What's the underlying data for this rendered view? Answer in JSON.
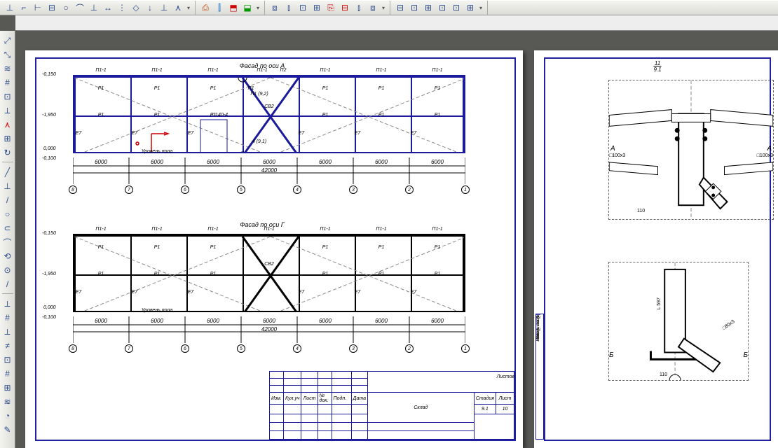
{
  "toolbars": {
    "top_groups": [
      [
        "⊥",
        "⌐",
        "⊢",
        "⊟",
        "○",
        "⌒",
        "⊥",
        "↔",
        "⋮",
        "◇",
        "↓",
        "⊥",
        "⋏"
      ],
      [
        "▸"
      ],
      [
        "⎙",
        "⫿",
        "⬒",
        "⬓"
      ],
      [
        "▸"
      ],
      [
        "⧈",
        "⫾",
        "⊡",
        "⊞",
        "⎘",
        "⊟",
        "⫾",
        "⧈"
      ],
      [
        "▸"
      ],
      [
        "⊟",
        "⊡",
        "⊞",
        "⊡",
        "⊡",
        "⊞"
      ],
      [
        "▸"
      ]
    ],
    "side": [
      "⤢",
      "⤡",
      "◇",
      "≋",
      "≋",
      "⊡",
      "⟂",
      "⋏",
      "⊞",
      "↻",
      "┊",
      "╱",
      "⊥",
      "/",
      "○",
      "⊂",
      "⌒",
      "⟲",
      "⊙",
      "/",
      "⟂",
      "#",
      "⟂",
      "≠",
      "⊡",
      "#",
      "⊞",
      "≋",
      "◔",
      "✎"
    ]
  },
  "sheet1": {
    "facade1": {
      "title": "Фасад по оси А",
      "elevations": [
        "-0,150",
        "-1,950",
        "0,000",
        "-0,100"
      ],
      "pt_labels": [
        "П1-1",
        "П1-1",
        "П1-1",
        "П1-1",
        "П2",
        "П1-1",
        "П1-1",
        "П1-1"
      ],
      "p_labels": [
        "Р1",
        "Р1",
        "Р1",
        "П1",
        "—",
        "Р1",
        "Р1",
        "Р1"
      ],
      "p2_labels": [
        "Р1",
        "Р1",
        "Р1",
        "□140-4",
        "СВ2",
        "Р1",
        "Р1",
        "Р1"
      ],
      "e_labels": [
        "Е7",
        "Е7",
        "Е7",
        "Е7",
        "Е7",
        "Е7",
        "Е7",
        "Е7"
      ],
      "note1": "П1 (9,2)",
      "note2": "4 (9,1)",
      "floor": "Уровень пола",
      "dims": [
        "6000",
        "6000",
        "6000",
        "6000",
        "6000",
        "6000",
        "6000"
      ],
      "total": "42000",
      "axes": [
        "8",
        "7",
        "6",
        "5",
        "4",
        "3",
        "2",
        "1"
      ]
    },
    "facade2": {
      "title": "Фасад по оси Г",
      "elevations": [
        "-0,150",
        "-1,950",
        "0,000",
        "-0,100"
      ],
      "pt_labels": [
        "П1-1",
        "П1-1",
        "П1-1",
        "П1-1",
        "П1-1",
        "П1-1",
        "П1-1",
        "—"
      ],
      "p_labels": [
        "Р1",
        "Р1",
        "Р1",
        "СВ2",
        "Р1",
        "Р1",
        "Р1"
      ],
      "p2_labels": [
        "Р1",
        "Р1",
        "Р1",
        "—",
        "Р1",
        "Р1",
        "Р1"
      ],
      "e_labels": [
        "Е7",
        "Е7",
        "Е7",
        "Е7",
        "Е7",
        "Е7",
        "Е7",
        "Е7"
      ],
      "floor": "Уровень пола",
      "dims": [
        "6000",
        "6000",
        "6000",
        "6000",
        "6000",
        "6000",
        "6000"
      ],
      "total": "42000",
      "axes": [
        "8",
        "7",
        "6",
        "5",
        "4",
        "3",
        "2",
        "1"
      ]
    },
    "titleblock": {
      "h_изм": "Изм.",
      "h_кул": "Кул.уч",
      "h_лист": "Лист",
      "h_док": "№ док.",
      "h_подп": "Подп.",
      "h_дата": "Дата",
      "project": "Склад",
      "stage_h": "Стадия",
      "sheet_h": "Лист",
      "sheets_h": "Листов",
      "stage": "",
      "sheet": "9.1",
      "sheets": "10"
    }
  },
  "sheet2": {
    "node_label": "11",
    "node_sub": "9.1",
    "side_labels": [
      "Инв. № подл.",
      "Подп. и дата",
      "Взам. инв №"
    ],
    "marks": [
      "А",
      "А",
      "Б",
      "Б"
    ],
    "dims": [
      "□100x3",
      "□100x3",
      "110",
      "L 597",
      "110",
      "□80x3"
    ]
  }
}
